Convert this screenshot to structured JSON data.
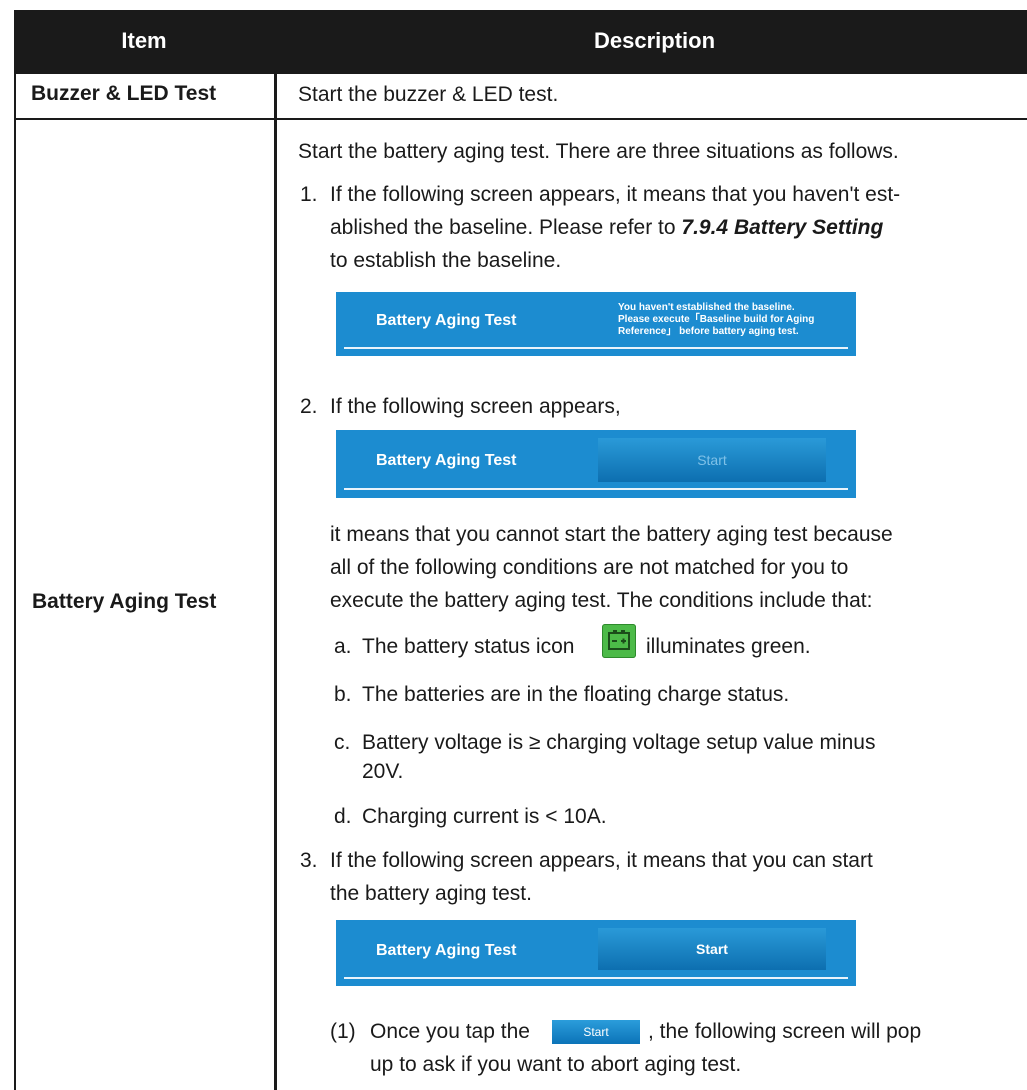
{
  "table": {
    "header": {
      "item": "Item",
      "description": "Description"
    },
    "rows": [
      {
        "item": "Buzzer & LED Test",
        "description": "Start the buzzer & LED test."
      },
      {
        "item": "Battery Aging Test"
      }
    ]
  },
  "aging": {
    "intro": "Start the battery aging test. There are three situations as follows.",
    "step1": {
      "num": "1.",
      "line1": "If the following screen appears, it means that you haven't est-",
      "line2_pre": "ablished the baseline. Please refer to ",
      "line2_ref": "7.9.4 Battery Setting",
      "line3": "to establish the baseline.",
      "panel_title": "Battery Aging Test",
      "panel_msg1": "You haven't established the baseline.",
      "panel_msg2": "Please execute「Baseline build for Aging",
      "panel_msg3": "Reference」 before battery aging test."
    },
    "step2": {
      "num": "2.",
      "line1": "If the following screen appears,",
      "panel_title": "Battery Aging Test",
      "panel_button": "Start",
      "cont1": "it means that you cannot start the battery aging test because",
      "cont2": "all of the following conditions are not matched for you to",
      "cont3": "execute the battery aging test. The conditions include that:",
      "conds": [
        {
          "letter": "a.",
          "pre": "The battery status icon",
          "post": "illuminates green."
        },
        {
          "letter": "b.",
          "text": "The batteries are in the floating charge status."
        },
        {
          "letter": "c.",
          "text": "Battery voltage is ≥ charging voltage setup value minus",
          "text2": "20V."
        },
        {
          "letter": "d.",
          "text": "Charging current is < 10A."
        }
      ]
    },
    "step3": {
      "num": "3.",
      "line1": "If the following screen appears, it means that you can start",
      "line2": "the battery aging test.",
      "panel_title": "Battery Aging Test",
      "panel_button": "Start",
      "sub": {
        "num": "(1)",
        "pre": "Once you tap the",
        "button": "Start",
        "post": ", the following screen will pop",
        "line2": "up to ask if you want to abort aging test."
      }
    }
  },
  "colors": {
    "panel": "#1c8cd0",
    "header": "#1a1a1a",
    "battery_icon": "#4cba48"
  },
  "icons": {
    "battery_status": "battery-icon"
  }
}
